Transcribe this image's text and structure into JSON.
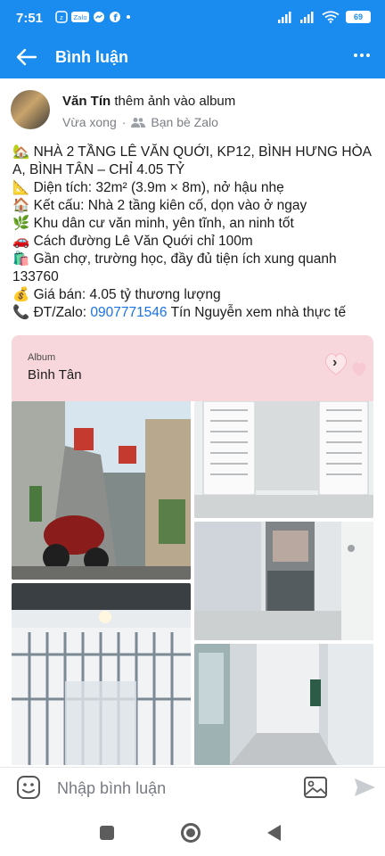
{
  "status_bar": {
    "time": "7:51",
    "app_icons": [
      "zalo-notification-icon",
      "zalo-badge-icon",
      "messenger-icon",
      "facebook-icon",
      "dot"
    ],
    "battery": "69"
  },
  "app_bar": {
    "title": "Bình luận"
  },
  "post": {
    "author": "Văn Tín",
    "action": "thêm ảnh vào album",
    "time": "Vừa xong",
    "audience": "Bạn bè Zalo",
    "lines": [
      "🏡 NHÀ 2 TẦNG LÊ VĂN QUỚI, KP12, BÌNH HƯNG HÒA",
      "A, BÌNH TÂN – CHỈ 4.05 TỶ",
      "📐 Diện tích: 32m² (3.9m × 8m), nở hậu nhẹ",
      "🏠 Kết cấu: Nhà 2 tầng kiên cố, dọn vào ở ngay",
      "🌿 Khu dân cư văn minh, yên tĩnh, an ninh tốt",
      "🚗 Cách đường Lê Văn Quới chỉ 100m",
      "🛍️ Gần chợ, trường học, đầy đủ tiện ích xung quanh",
      "133760",
      "💰 Giá bán: 4.05 tỷ thương lượng"
    ],
    "contact_prefix": "📞 ĐT/Zalo: ",
    "contact_phone": "0907771546",
    "contact_suffix": " Tín Nguyễn xem nhà thực tế"
  },
  "album": {
    "label": "Album",
    "title": "Bình Tân"
  },
  "comment_bar": {
    "placeholder": "Nhập bình luận"
  },
  "colors": {
    "accent": "#1a8cf0",
    "album_background": "#f8d7dc",
    "link": "#1a73e8"
  }
}
